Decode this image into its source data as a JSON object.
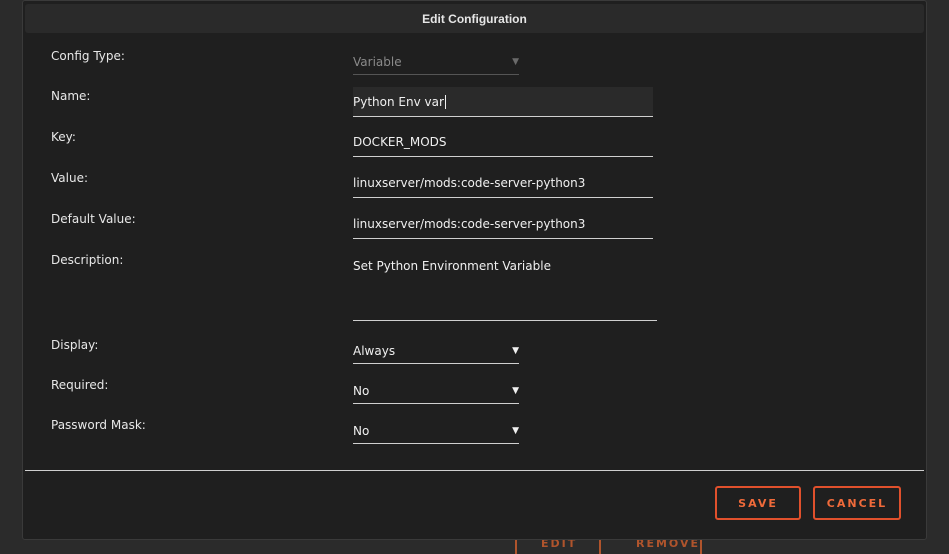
{
  "dialog": {
    "title": "Edit Configuration"
  },
  "background": {
    "edit_label": "EDIT",
    "remove_label": "REMOVE"
  },
  "form": {
    "config_type": {
      "label": "Config Type:",
      "value": "Variable"
    },
    "name": {
      "label": "Name:",
      "value": "Python Env var"
    },
    "key": {
      "label": "Key:",
      "value": "DOCKER_MODS"
    },
    "value": {
      "label": "Value:",
      "value": "linuxserver/mods:code-server-python3"
    },
    "default_value": {
      "label": "Default Value:",
      "value": "linuxserver/mods:code-server-python3"
    },
    "description": {
      "label": "Description:",
      "value": "Set Python Environment Variable"
    },
    "display": {
      "label": "Display:",
      "value": "Always"
    },
    "required": {
      "label": "Required:",
      "value": "No"
    },
    "password_mask": {
      "label": "Password Mask:",
      "value": "No"
    }
  },
  "actions": {
    "save_label": "SAVE",
    "cancel_label": "CANCEL"
  },
  "colors": {
    "accent": "#f06a3a",
    "dialog_bg": "#1f1f1f",
    "header_bg": "#2a2a2a",
    "text": "#e8e8e8"
  }
}
